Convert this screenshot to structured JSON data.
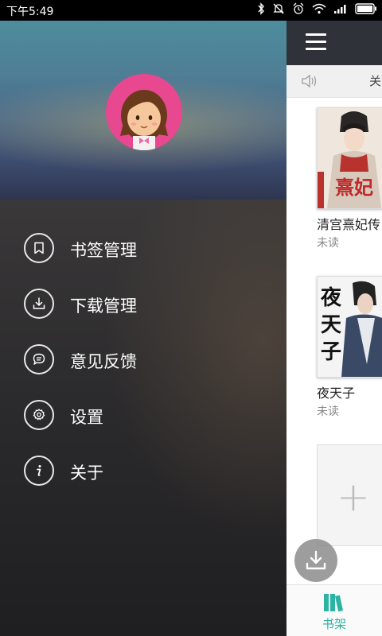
{
  "status_bar": {
    "time": "下午5:49"
  },
  "drawer": {
    "menu": [
      {
        "label": "书签管理",
        "icon": "bookmark-icon"
      },
      {
        "label": "下载管理",
        "icon": "download-icon"
      },
      {
        "label": "意见反馈",
        "icon": "chat-icon"
      },
      {
        "label": "设置",
        "icon": "gear-icon"
      },
      {
        "label": "关于",
        "icon": "info-icon"
      }
    ]
  },
  "main": {
    "notice_text": "关",
    "books": [
      {
        "title": "清宫熹妃传",
        "status": "未读",
        "cover_text": "熹妃"
      },
      {
        "title": "夜天子",
        "status": "未读",
        "cover_text": "夜天子"
      }
    ],
    "add_symbol": "+",
    "bottom_tab": "书架"
  },
  "colors": {
    "accent": "#2bb3a3",
    "appbar": "#2f3238",
    "avatar_bg": "#e7488f"
  }
}
